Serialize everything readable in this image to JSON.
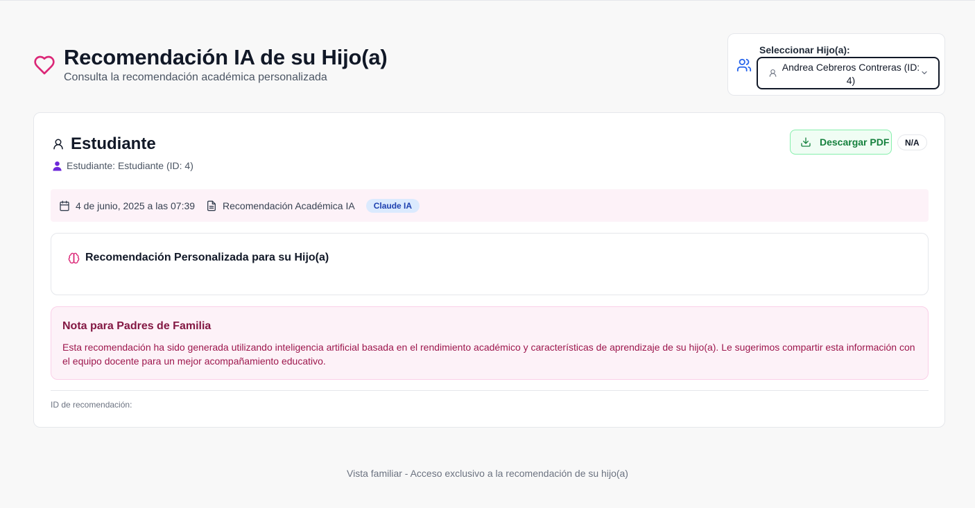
{
  "header": {
    "title": "Recomendación IA de su Hijo(a)",
    "subtitle": "Consulta la recomendación académica personalizada"
  },
  "selector": {
    "label": "Seleccionar Hijo(a):",
    "selected_value": "Andrea Cebreros Contreras (ID: 4)"
  },
  "student": {
    "title": "Estudiante",
    "meta": "Estudiante: Estudiante (ID: 4)"
  },
  "actions": {
    "download_pdf": "Descargar PDF",
    "status_badge": "N/A"
  },
  "info_bar": {
    "date": "4 de junio, 2025 a las 07:39",
    "type": "Recomendación Académica IA",
    "ai_badge": "Claude IA"
  },
  "recommendation": {
    "title": "Recomendación Personalizada para su Hijo(a)"
  },
  "note": {
    "title": "Nota para Padres de Familia",
    "text": "Esta recomendación ha sido generada utilizando inteligencia artificial basada en el rendimiento académico y características de aprendizaje de su hijo(a). Le sugerimos compartir esta información con el equipo docente para un mejor acompañamiento educativo."
  },
  "recommendation_id_label": "ID de recomendación:",
  "footer": "Vista familiar - Acceso exclusivo a la recomendación de su hijo(a)",
  "colors": {
    "accent_pink": "#db2777",
    "accent_blue": "#2563eb",
    "pdf_green": "#15803d",
    "note_bg": "#fdf2f8"
  },
  "icons": [
    "heart-icon",
    "users-icon",
    "person-icon",
    "chevron-down-icon",
    "download-icon",
    "calendar-icon",
    "file-text-icon",
    "brain-icon"
  ]
}
